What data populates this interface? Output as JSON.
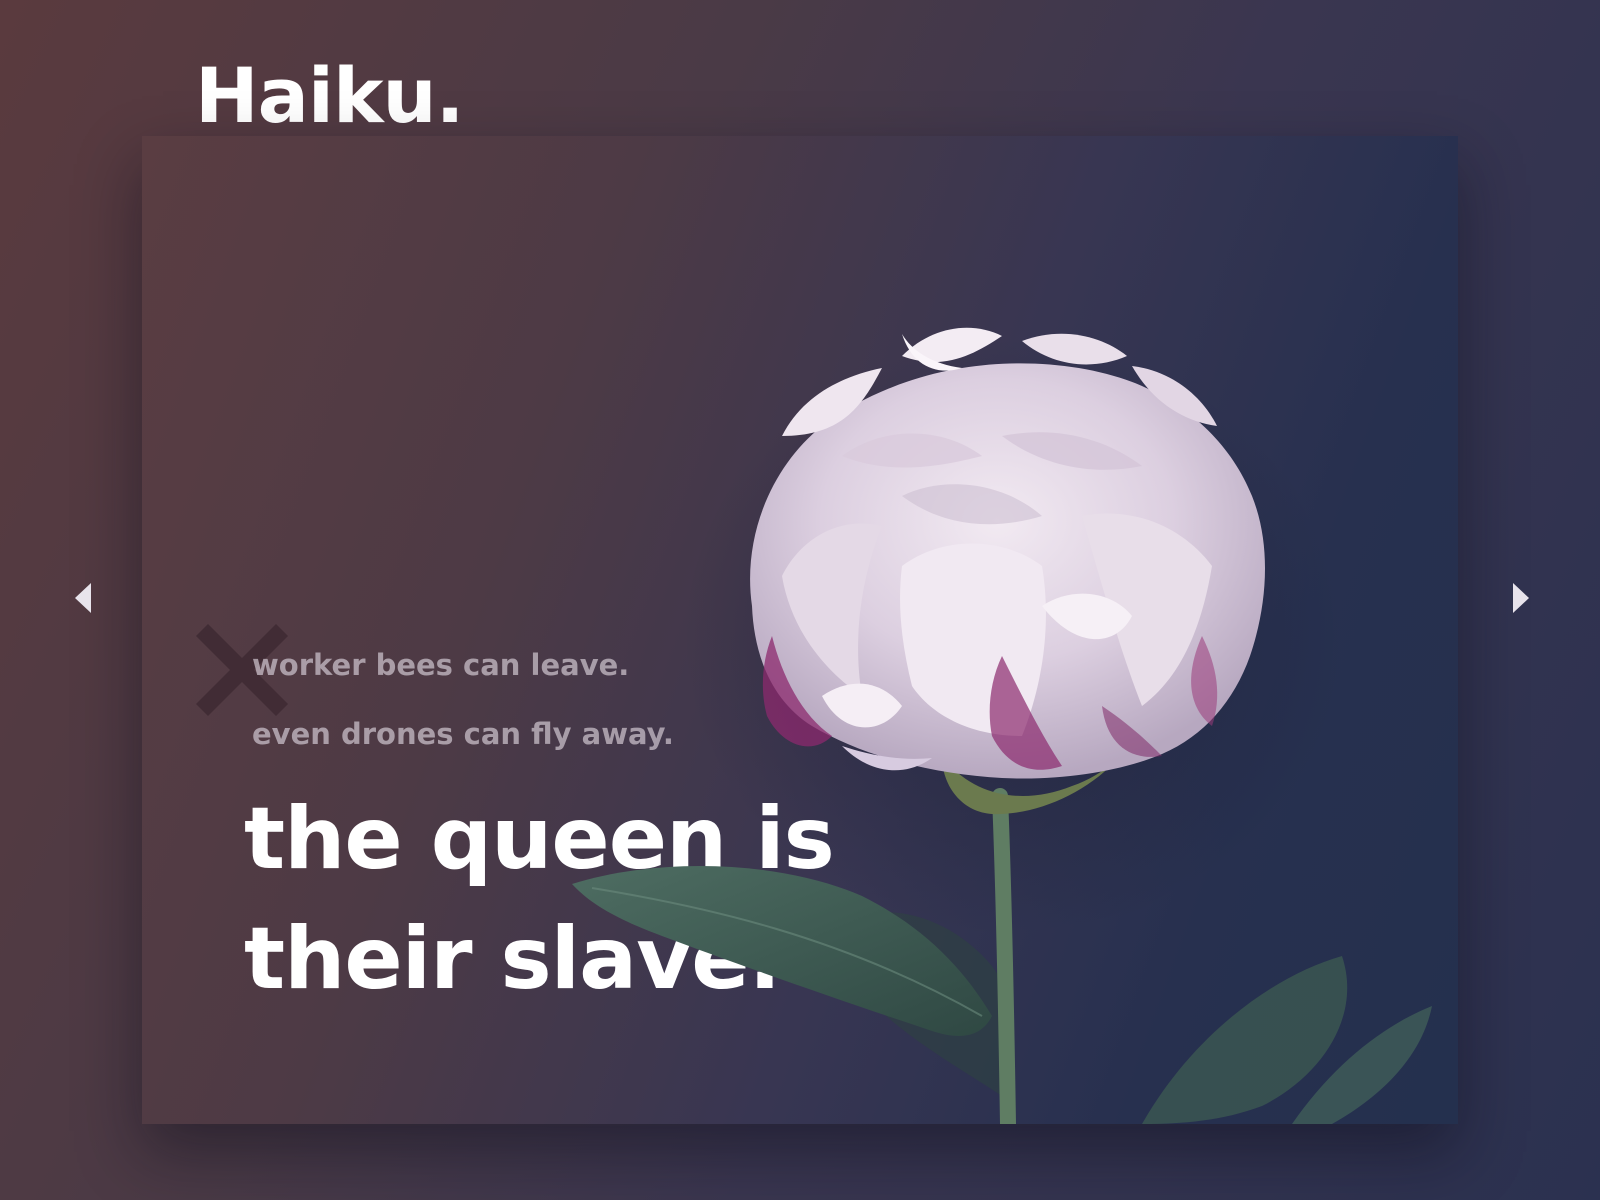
{
  "brand": {
    "title": "Haiku."
  },
  "haiku": {
    "line1": "worker bees can leave.",
    "line2": "even drones can fly away.",
    "line3": "the queen is",
    "line4": "their slave."
  },
  "icons": {
    "prev": "caret-left-icon",
    "next": "caret-right-icon",
    "mark": "cross-mark-icon"
  },
  "colors": {
    "background_warm": "#5a3a3e",
    "background_cool": "#2b3150",
    "title_text": "#ffffff",
    "secondary_text": "#cdc3cd",
    "petal": "#e6dbe6",
    "petal_accent": "#8c2a6e",
    "leaf": "#3f5a52"
  }
}
